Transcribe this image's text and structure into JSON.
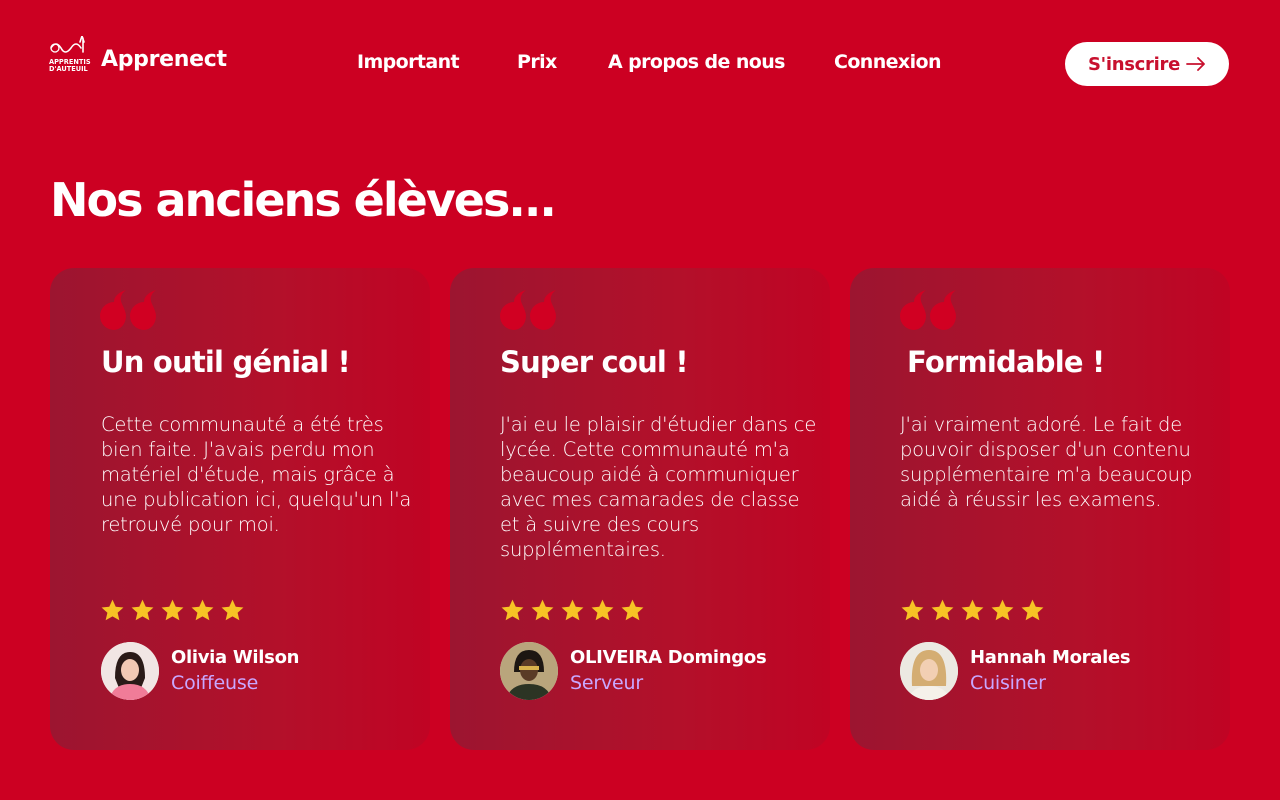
{
  "header": {
    "logo_text": "APPRENTIS D'AUTEUIL",
    "brand": "Apprenect",
    "nav": [
      "Important",
      "Prix",
      "A propos de nous",
      "Connexion"
    ],
    "signup_label": "S'inscrire"
  },
  "page_title": "Nos anciens élèves...",
  "testimonials": [
    {
      "title": "Un outil génial !",
      "text": "Cette communauté a été très bien faite. J'avais perdu mon matériel d'étude, mais grâce à une publication ici, quelqu'un l'a retrouvé pour moi.",
      "rating": 5,
      "name": "Olivia Wilson",
      "role": "Coiffeuse"
    },
    {
      "title": "Super coul !",
      "text": "J'ai eu le plaisir d'étudier dans ce lycée. Cette communauté m'a beaucoup aidé à communiquer avec mes camarades de classe et à suivre des cours supplémentaires.",
      "rating": 5,
      "name": "OLIVEIRA Domingos",
      "role": "Serveur"
    },
    {
      "title": "Formidable !",
      "text": "J'ai vraiment adoré. Le fait de pouvoir disposer d'un contenu supplémentaire m'a beaucoup aidé à réussir les examens.",
      "rating": 5,
      "name": "Hannah Morales",
      "role": "Cuisiner"
    }
  ],
  "colors": {
    "background": "#cc0022",
    "accent_red": "#c8102e",
    "star": "#f7c325",
    "role_text": "#c9a7ff"
  },
  "icons": [
    "apprentis-dauteuil-logo",
    "arrow-right-icon",
    "quote-icon",
    "star-icon"
  ]
}
